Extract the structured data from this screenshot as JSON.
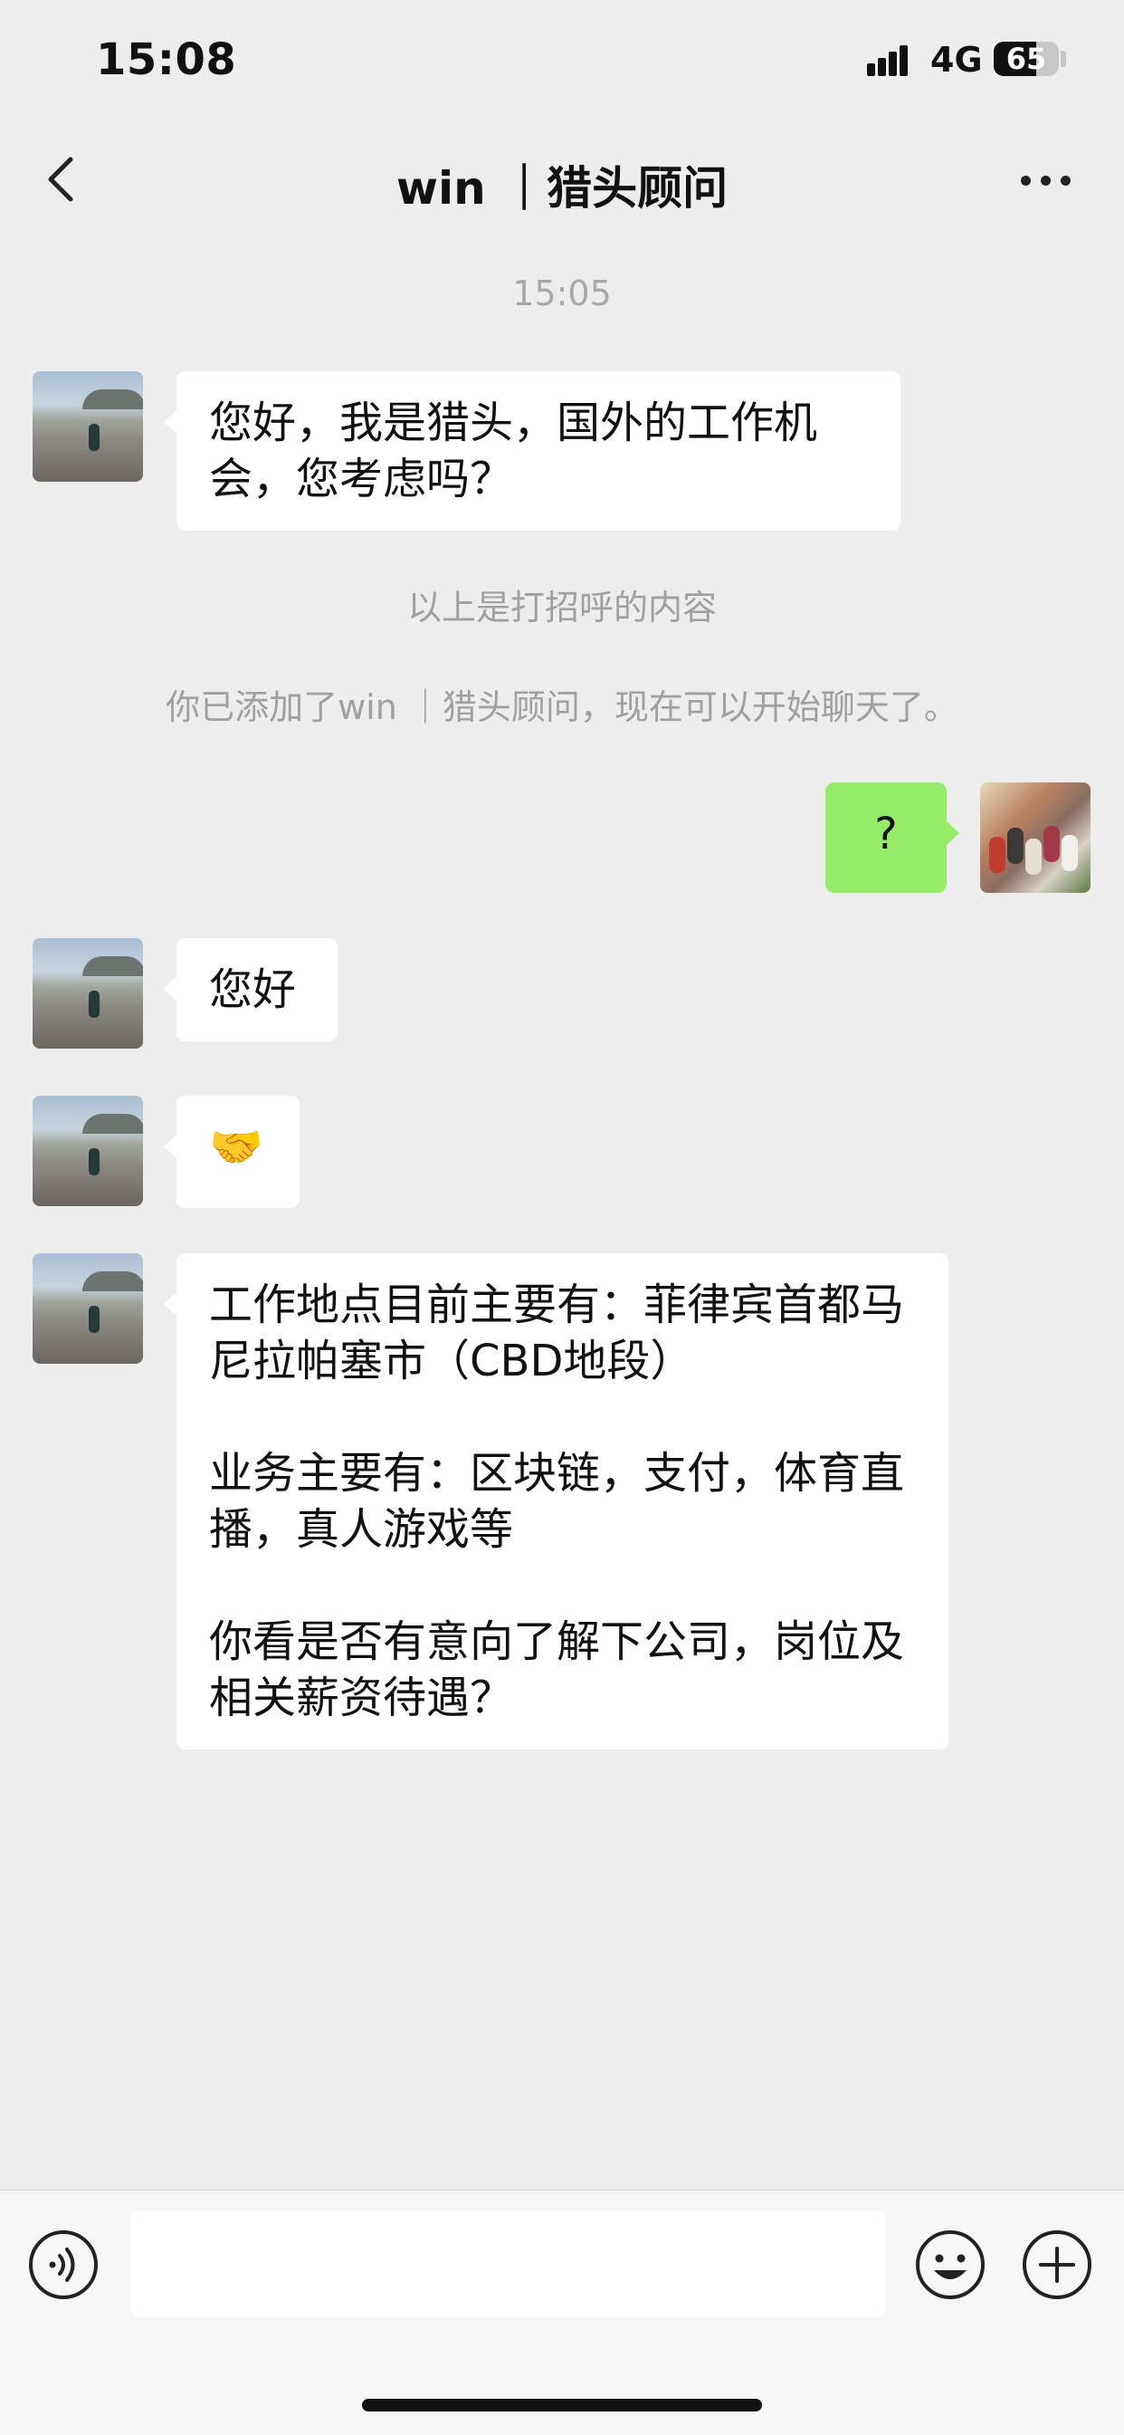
{
  "status_bar": {
    "time": "15:08",
    "network": "4G",
    "battery": "65",
    "battery_level": 0.65
  },
  "header": {
    "title": "win ｜猎头顾问",
    "back_icon": "chevron-left-icon",
    "more_icon": "ellipsis-icon"
  },
  "chat": {
    "timestamp": "15:05",
    "messages": [
      {
        "side": "left",
        "text": "您好，我是猎头，国外的工作机会，您考虑吗？"
      },
      {
        "side": "left",
        "text": "您好"
      },
      {
        "side": "left",
        "emoji": "🤝"
      },
      {
        "side": "left",
        "text": "工作地点目前主要有：菲律宾首都马尼拉帕塞市（CBD地段）\n\n业务主要有：区块链，支付，体育直播，真人游戏等\n\n你看是否有意向了解下公司，岗位及相关薪资待遇？"
      },
      {
        "side": "right",
        "text": "?"
      }
    ],
    "greeting_note": "以上是打招呼的内容",
    "added_note": "你已添加了win ｜猎头顾问，现在可以开始聊天了。"
  },
  "input_bar": {
    "voice_icon": "voice-icon",
    "emoji_icon": "emoji-icon",
    "plus_icon": "plus-icon",
    "input_value": ""
  },
  "colors": {
    "background": "#ededed",
    "sent_bubble": "#95ec69",
    "received_bubble": "#ffffff"
  }
}
